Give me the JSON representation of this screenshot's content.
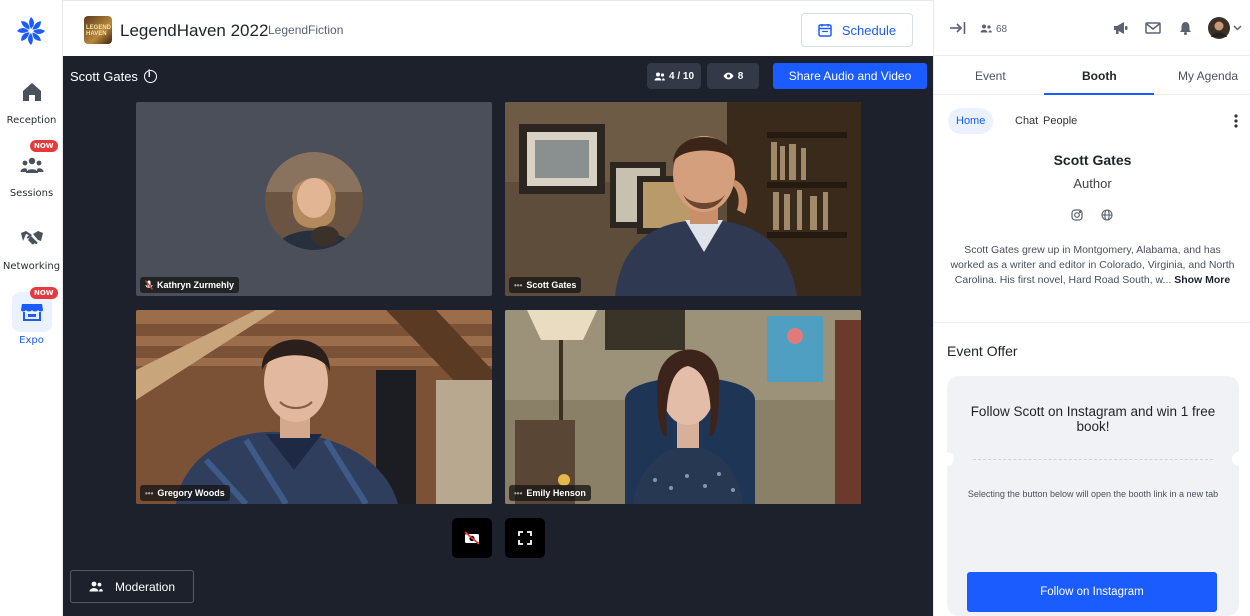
{
  "nav": {
    "items": [
      {
        "label": "Reception",
        "icon": "home-icon"
      },
      {
        "label": "Sessions",
        "icon": "people-group-icon",
        "badge": "NOW"
      },
      {
        "label": "Networking",
        "icon": "handshake-icon"
      },
      {
        "label": "Expo",
        "icon": "storefront-icon",
        "badge": "NOW"
      }
    ]
  },
  "header": {
    "event_title": "LegendHaven 2022",
    "organizer": "LegendFiction",
    "event_logo_text": "LEGEND HAVEN",
    "schedule_label": "Schedule"
  },
  "stage": {
    "title": "Scott Gates",
    "participants": "4 / 10",
    "viewers": "8",
    "share_label": "Share Audio and Video",
    "moderation_label": "Moderation",
    "tiles": [
      {
        "name": "Kathryn Zurmehly",
        "video": "off"
      },
      {
        "name": "Scott Gates",
        "video": "on",
        "speaking": true
      },
      {
        "name": "Gregory Woods",
        "video": "on"
      },
      {
        "name": "Emily Henson",
        "video": "on"
      }
    ]
  },
  "right_panel": {
    "attendee_count": "68",
    "main_tabs": [
      "Event",
      "Booth",
      "My Agenda"
    ],
    "active_main_tab": "Booth",
    "sub_tabs": [
      "Home",
      "Chat",
      "People"
    ],
    "active_sub_tab": "Home",
    "booth": {
      "name": "Scott Gates",
      "role": "Author",
      "bio": "Scott Gates grew up in Montgomery, Alabama, and has worked as a writer and editor in Colorado, Virginia, and North Carolina. His first novel, Hard Road South, w...",
      "show_more": "Show More"
    },
    "offer": {
      "heading": "Event Offer",
      "title": "Follow Scott on Instagram and win 1 free book!",
      "note": "Selecting the button below will open the booth link in a new tab",
      "button_label": "Follow on Instagram"
    }
  },
  "colors": {
    "accent": "#1a5cff",
    "stage_bg": "#1d212c",
    "badge_red": "#e5393b"
  }
}
